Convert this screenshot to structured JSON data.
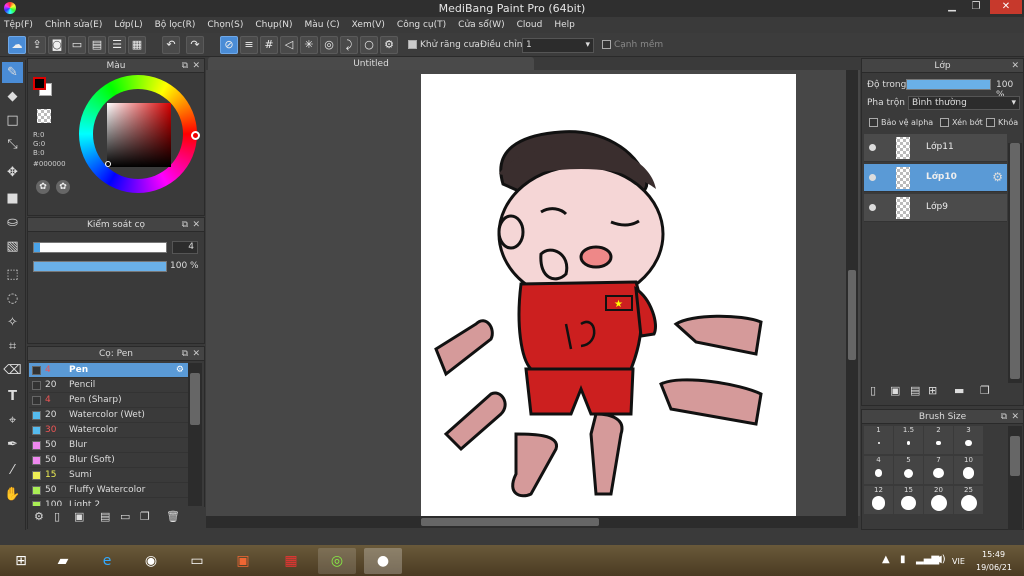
{
  "window": {
    "title": "MediBang Paint Pro (64bit)"
  },
  "menu": [
    "Tệp(F)",
    "Chỉnh sửa(E)",
    "Lớp(L)",
    "Bộ lọc(R)",
    "Chọn(S)",
    "Chụp(N)",
    "Màu (C)",
    "Xem(V)",
    "Công cụ(T)",
    "Cửa sổ(W)",
    "Cloud",
    "Help"
  ],
  "toolbar": {
    "antialias_label": "Khử răng cưa",
    "adjust_label": "Điều chỉnh",
    "adjust_value": "1",
    "edge_label": "Cạnh mềm"
  },
  "color_panel": {
    "title": "Màu",
    "r_label": "R:0",
    "g_label": "G:0",
    "b_label": "B:0",
    "hex": "#000000",
    "primary_color": "#000000",
    "secondary_color": "#ffffff",
    "accent_color": "#d60000"
  },
  "brush_control": {
    "title": "Kiểm soát cọ",
    "size_value": "4",
    "opacity_value": "100 %",
    "opacity_fraction": 1.0
  },
  "brush_panel": {
    "title": "Cọ: Pen",
    "items": [
      {
        "size": "4",
        "name": "Pen",
        "color": "#333333",
        "size_color": "#e55",
        "selected": true
      },
      {
        "size": "20",
        "name": "Pencil",
        "color": "#333333",
        "size_color": "#ddd"
      },
      {
        "size": "4",
        "name": "Pen (Sharp)",
        "color": "#333333",
        "size_color": "#e55"
      },
      {
        "size": "20",
        "name": "Watercolor (Wet)",
        "color": "#55bbee",
        "size_color": "#ddd"
      },
      {
        "size": "30",
        "name": "Watercolor",
        "color": "#55bbee",
        "size_color": "#e55"
      },
      {
        "size": "50",
        "name": "Blur",
        "color": "#ee88ee",
        "size_color": "#ddd"
      },
      {
        "size": "50",
        "name": "Blur (Soft)",
        "color": "#ee88ee",
        "size_color": "#ddd"
      },
      {
        "size": "15",
        "name": "Sumi",
        "color": "#eeee55",
        "size_color": "#ee5"
      },
      {
        "size": "50",
        "name": "Fluffy Watercolor",
        "color": "#aaee55",
        "size_color": "#ddd"
      },
      {
        "size": "100",
        "name": "Light 2",
        "color": "#aaee55",
        "size_color": "#ddd"
      }
    ]
  },
  "canvas": {
    "tab_title": "Untitled"
  },
  "layer_panel": {
    "title": "Lớp",
    "opacity_label": "Độ trong",
    "opacity_value": "100 %",
    "opacity_fraction": 1.0,
    "blend_label": "Pha trộn",
    "blend_value": "Bình thường",
    "protect_alpha": "Bảo vệ alpha",
    "clipping": "Xén bớt",
    "lock": "Khóa",
    "layers": [
      {
        "name": "Lớp11",
        "selected": false
      },
      {
        "name": "Lớp10",
        "selected": true
      },
      {
        "name": "Lớp9",
        "selected": false
      }
    ]
  },
  "brush_size_panel": {
    "title": "Brush Size",
    "sizes": [
      "1",
      "1.5",
      "2",
      "3",
      "4",
      "5",
      "7",
      "10",
      "12",
      "15",
      "20",
      "25"
    ]
  },
  "taskbar": {
    "lang": "VIE",
    "time": "15:49",
    "date": "19/06/21"
  }
}
